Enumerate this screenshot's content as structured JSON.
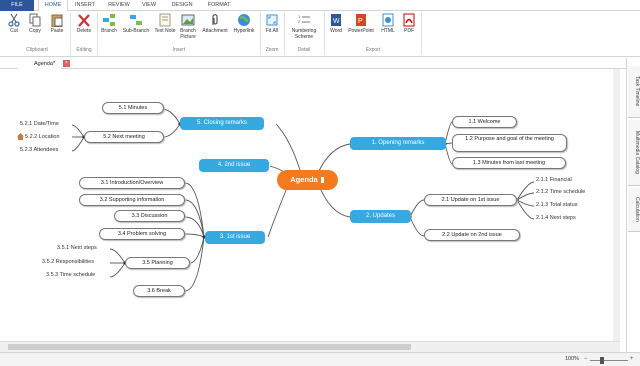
{
  "ribbon_tabs": [
    "FILE",
    "HOME",
    "INSERT",
    "REVIEW",
    "VIEW",
    "DESIGN",
    "FORMAT"
  ],
  "ribbon": {
    "buttons": [
      "Cut",
      "Copy",
      "Paste",
      "Delete",
      "Branch",
      "Sub-Branch",
      "Text Note",
      "Branch Picture",
      "Attachment",
      "Hyperlink",
      "Fit All",
      "Numbering Scheme",
      "Word",
      "PowerPoint",
      "HTML",
      "PDF"
    ],
    "groups": [
      "Clipboard",
      "Editing",
      "Insert",
      "Zoom",
      "Detail",
      "Export"
    ]
  },
  "document_tab": {
    "label": "Agenda*"
  },
  "side_tabs": [
    "Task Timeline",
    "Multimedia Catalog",
    "Calculation"
  ],
  "status": {
    "zoom": "100%"
  },
  "mindmap": {
    "central": "Agenda",
    "branches": {
      "b1": "1.  Opening remarks",
      "b2": "2.  Updates",
      "b3": "3.  1st issue",
      "b4": "4.  2nd issue",
      "b5": "5.  Closing remarks"
    },
    "subs": {
      "s11": "1.1  Welcome",
      "s12": "1.2    Purpose and goal of the meeting",
      "s13": "1.3  Minutes from last meeting",
      "s21": "2.1  Update on 1st issue",
      "s22": "2.2  Update on 2nd issue",
      "s31": "3.1  Introduction/Overview",
      "s32": "3.2  Supporting information",
      "s33": "3.3  Discussion",
      "s34": "3.4  Problem solving",
      "s35": "3.5  Planning",
      "s36": "3.6  Break",
      "s51": "5.1  Minutes",
      "s52": "5.2  Next meeting"
    },
    "leaves": {
      "l211": "2.1.1  Financial",
      "l212": "2.1.2  Time schedule",
      "l213": "2.1.3  Total status",
      "l214": "2.1.4  Next steps",
      "l351": "3.5.1  Next steps",
      "l352": "3.5.2  Responsibilities",
      "l353": "3.5.3  Time schedule",
      "l521": "5.2.1  Date/Time",
      "l522": "5.2.2  Location",
      "l523": "5.2.3  Attendees"
    }
  },
  "colors": {
    "accent": "#2b579a",
    "branch": "#36a9e1",
    "central": "#f57a1f"
  }
}
